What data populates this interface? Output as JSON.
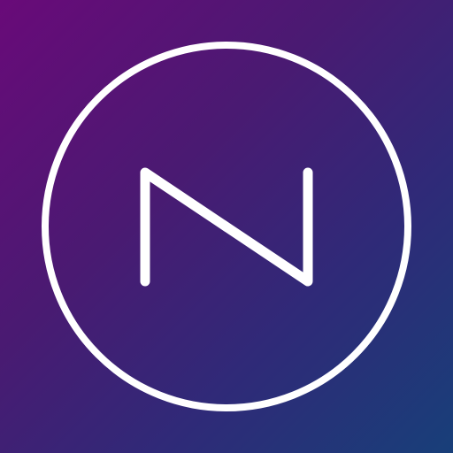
{
  "icon": {
    "semantic": "n-letter-logo-icon",
    "letter": "N",
    "colors": {
      "gradient_start": "#690a79",
      "gradient_mid": "#4a1a72",
      "gradient_end": "#183f79",
      "stroke": "#ffffff"
    }
  }
}
